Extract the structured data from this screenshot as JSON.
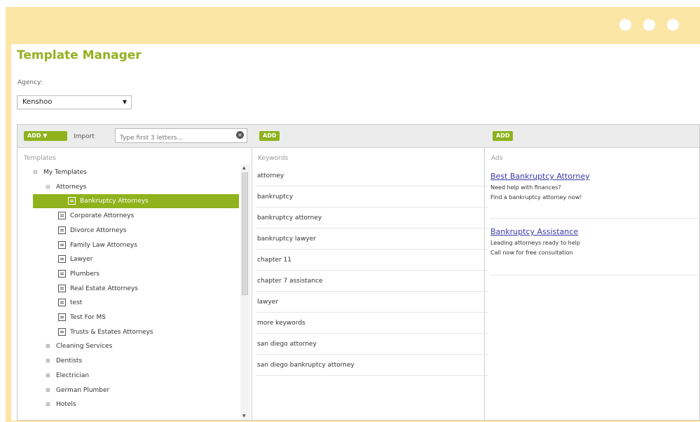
{
  "window": {
    "controls": [
      "dot",
      "dot",
      "dot"
    ]
  },
  "page": {
    "title": "Template Manager"
  },
  "agency": {
    "label": "Agency:",
    "selected": "Kenshoo"
  },
  "toolbar": {
    "add_dropdown_label": "ADD ▼",
    "import_label": "Import",
    "search_placeholder": "Type first 3 letters...",
    "keywords_add_label": "ADD",
    "ads_add_label": "ADD"
  },
  "templates": {
    "header": "Templates",
    "tree": [
      {
        "label": "My Templates",
        "level": 0,
        "type": "folder",
        "expander": "⊟"
      },
      {
        "label": "Attorneys",
        "level": 1,
        "type": "folder",
        "expander": "⊟"
      },
      {
        "label": "Bankruptcy Attorneys",
        "level": 2,
        "type": "template",
        "selected": true
      },
      {
        "label": "Corporate Attorneys",
        "level": 2,
        "type": "template"
      },
      {
        "label": "Divorce Attorneys",
        "level": 2,
        "type": "template"
      },
      {
        "label": "Family Law Attorneys",
        "level": 2,
        "type": "template"
      },
      {
        "label": "Lawyer",
        "level": 2,
        "type": "template"
      },
      {
        "label": "Plumbers",
        "level": 2,
        "type": "template"
      },
      {
        "label": "Real Estate Attorneys",
        "level": 2,
        "type": "template"
      },
      {
        "label": "test",
        "level": 2,
        "type": "template"
      },
      {
        "label": "Test For MS",
        "level": 2,
        "type": "template"
      },
      {
        "label": "Trusts & Estates Attorneys",
        "level": 2,
        "type": "template"
      },
      {
        "label": "Cleaning Services",
        "level": 1,
        "type": "folder",
        "expander": "⊞"
      },
      {
        "label": "Dentists",
        "level": 1,
        "type": "folder",
        "expander": "⊞"
      },
      {
        "label": "Electrician",
        "level": 1,
        "type": "folder",
        "expander": "⊞"
      },
      {
        "label": "German Plumber",
        "level": 1,
        "type": "folder",
        "expander": "⊞"
      },
      {
        "label": "Hotels",
        "level": 1,
        "type": "folder",
        "expander": "⊞"
      }
    ]
  },
  "keywords": {
    "header": "Keywords",
    "items": [
      "attorney",
      "bankruptcy",
      "bankruptcy attorney",
      "bankruptcy lawyer",
      "chapter 11",
      "chapter 7 assistance",
      "lawyer",
      "more keywords",
      "san diego attorney",
      "san diego bankruptcy attorney"
    ]
  },
  "ads": {
    "header": "Ads",
    "items": [
      {
        "headline": "Best Bankruptcy Attorney",
        "line1": "Need help with finances?",
        "line2": "Find a bankruptcy attorney now!"
      },
      {
        "headline": "Bankruptcy Assistance",
        "line1": "Leading attorneys ready to help",
        "line2": "Call now for free consultation"
      }
    ]
  },
  "colors": {
    "accent": "#8fb21d",
    "frame": "#fce6a6",
    "link": "#3a3aa8"
  }
}
